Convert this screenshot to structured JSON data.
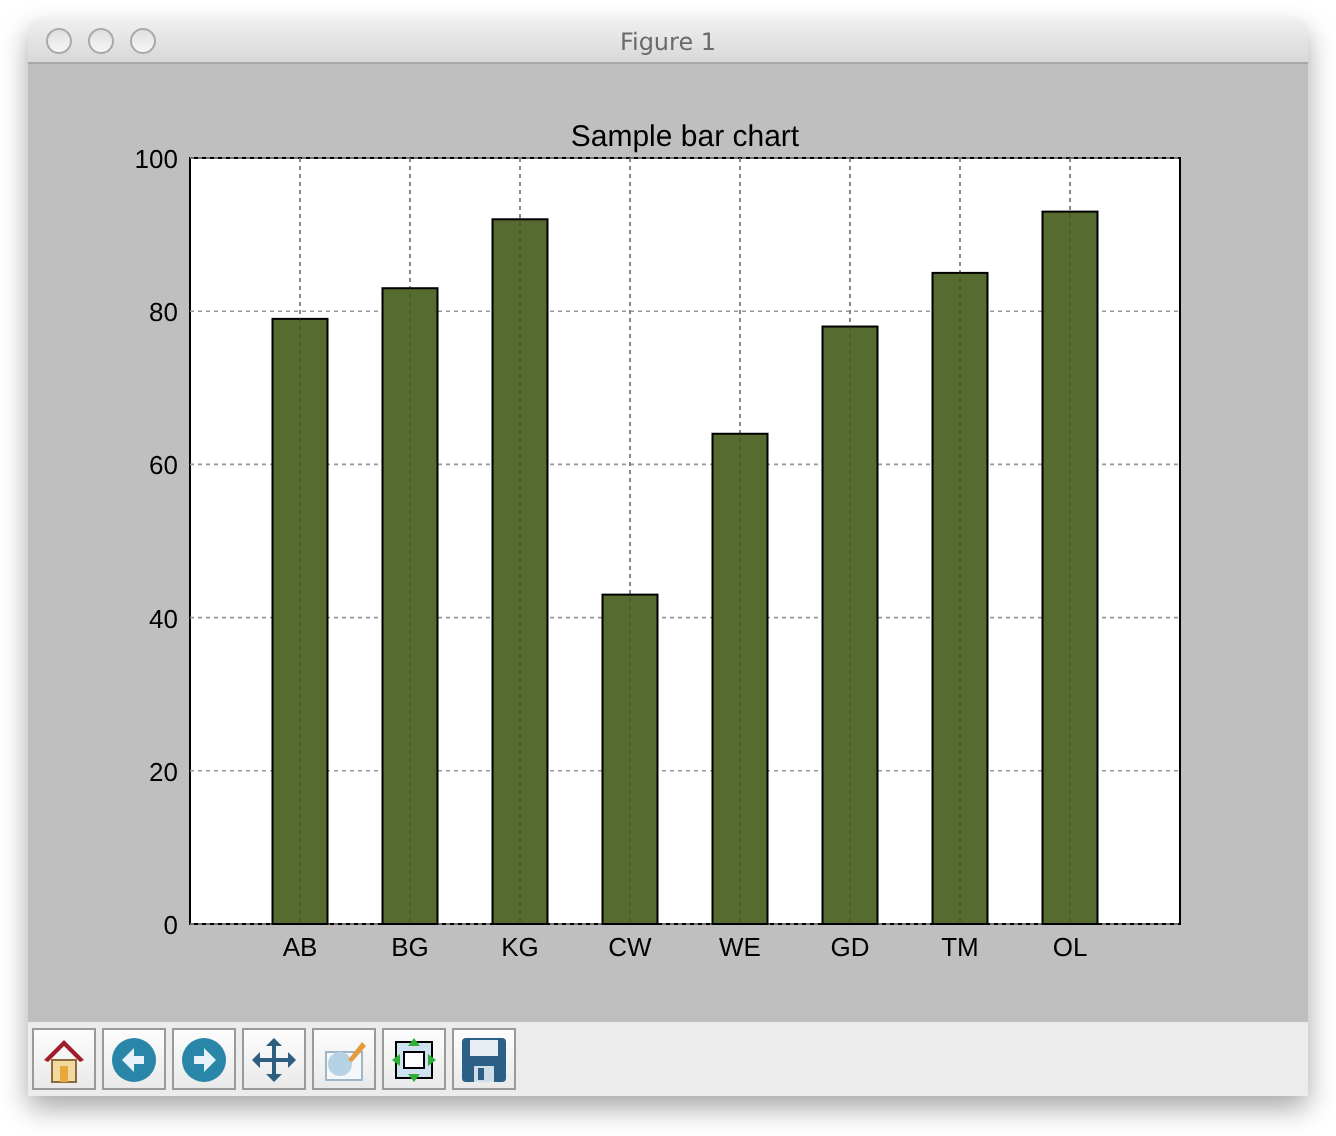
{
  "window": {
    "title": "Figure 1"
  },
  "figure": {
    "chart_data": {
      "type": "bar",
      "title": "Sample bar chart",
      "categories": [
        "AB",
        "BG",
        "KG",
        "CW",
        "WE",
        "GD",
        "TM",
        "OL"
      ],
      "series": [
        {
          "color": "#556b2f",
          "values": [
            79,
            83,
            92,
            43,
            64,
            78,
            85,
            93
          ]
        }
      ],
      "ylim": [
        0,
        100
      ],
      "yticks": [
        0,
        20,
        40,
        60,
        80,
        100
      ],
      "grid": true
    }
  },
  "toolbar": [
    {
      "kind": "home"
    },
    {
      "kind": "back"
    },
    {
      "kind": "forward"
    },
    {
      "kind": "pan"
    },
    {
      "kind": "zoom"
    },
    {
      "kind": "subplots"
    },
    {
      "kind": "save"
    }
  ]
}
